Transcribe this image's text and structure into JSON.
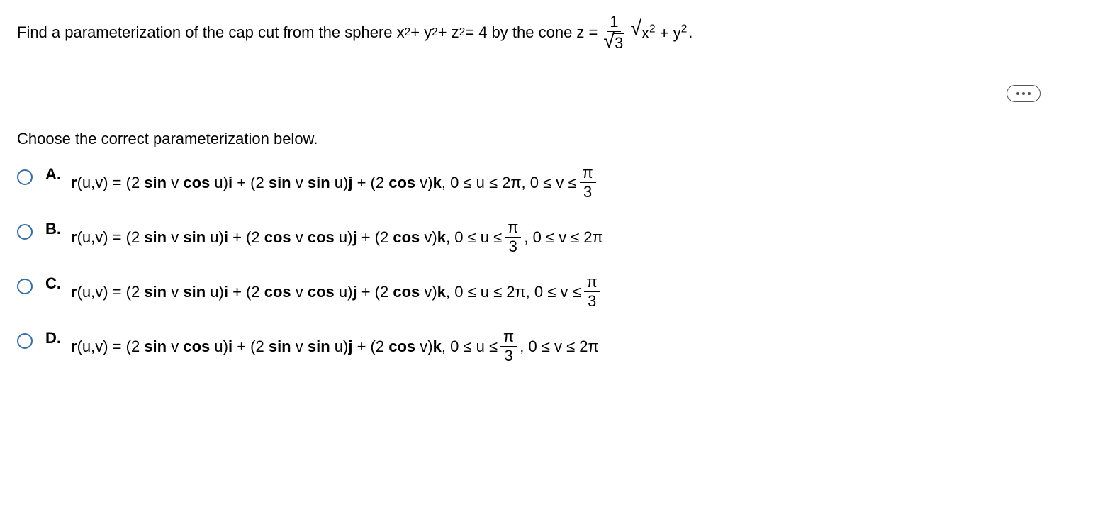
{
  "question": {
    "prefix": "Find a parameterization of the cap cut from the sphere x",
    "mid1": " + y",
    "mid2": " + z",
    "mid3": " = 4 by the cone z = ",
    "frac_num": "1",
    "frac_den_sqrt": "3",
    "sqrt_x": "x",
    "sqrt_plus": " + y",
    "period": " .",
    "sup2": "2"
  },
  "instruction": "Choose the correct parameterization below.",
  "options": [
    {
      "letter": "A.",
      "prefix": "r(u,v) = (2 sin v cos u)i + (2 sin v sin u)j + (2 cos v)k, 0 ≤ u ≤ 2π, 0 ≤ v ≤ ",
      "frac_num": "π",
      "frac_den": "3",
      "suffix": ""
    },
    {
      "letter": "B.",
      "prefix": "r(u,v) = (2 sin v sin u)i + (2 cos v cos u)j + (2 cos v)k, 0 ≤ u ≤ ",
      "frac_num": "π",
      "frac_den": "3",
      "suffix": ", 0 ≤ v ≤ 2π"
    },
    {
      "letter": "C.",
      "prefix": "r(u,v) = (2 sin v sin u)i + (2 cos v cos u)j + (2 cos v)k, 0 ≤ u ≤ 2π, 0 ≤ v ≤ ",
      "frac_num": "π",
      "frac_den": "3",
      "suffix": ""
    },
    {
      "letter": "D.",
      "prefix": "r(u,v) = (2 sin v cos u)i + (2 sin v sin u)j + (2 cos v)k, 0 ≤ u ≤ ",
      "frac_num": "π",
      "frac_den": "3",
      "suffix": ", 0 ≤ v ≤ 2π"
    }
  ]
}
